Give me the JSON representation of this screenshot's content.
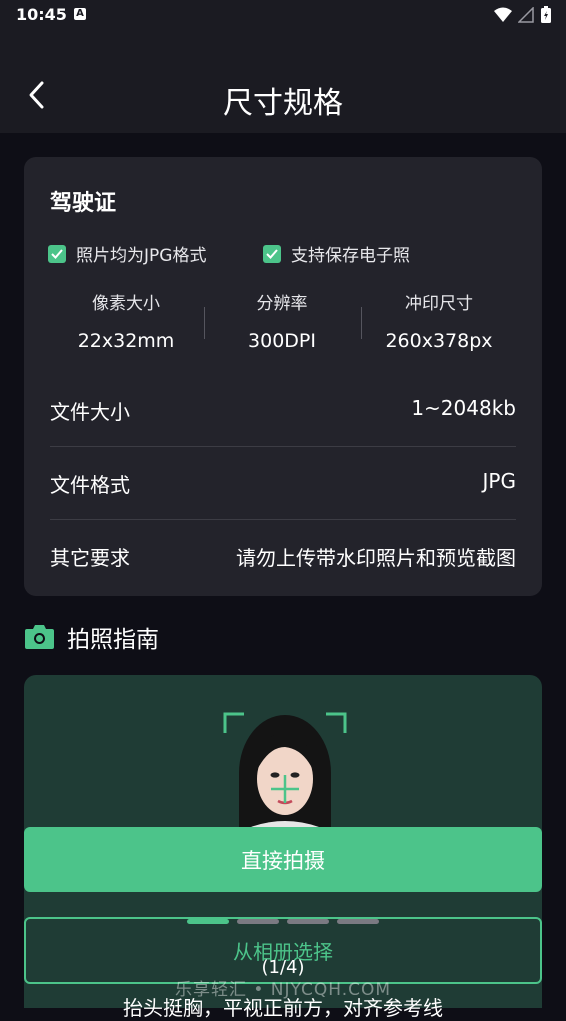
{
  "status_bar": {
    "time": "10:45",
    "notification_glyph": "A"
  },
  "header": {
    "title": "尺寸规格"
  },
  "spec": {
    "title": "驾驶证",
    "checks": [
      "照片均为JPG格式",
      "支持保存电子照"
    ],
    "metrics": [
      {
        "label": "像素大小",
        "value": "22x32mm"
      },
      {
        "label": "分辨率",
        "value": "300DPI"
      },
      {
        "label": "冲印尺寸",
        "value": "260x378px"
      }
    ],
    "rows": [
      {
        "label": "文件大小",
        "value": "1~2048kb"
      },
      {
        "label": "文件格式",
        "value": "JPG"
      },
      {
        "label": "其它要求",
        "value": "请勿上传带水印照片和预览截图"
      }
    ]
  },
  "guide": {
    "title": "拍照指南",
    "page_indicator": "(1/4)",
    "caption": "抬头挺胸，平视正前方，对齐参考线"
  },
  "actions": {
    "shoot": "直接拍摄",
    "album": "从相册选择"
  },
  "watermark": "乐享轻汇 • NJYCQH.COM",
  "colors": {
    "accent": "#4cc48a",
    "background": "#0e0e16",
    "card": "#23232b",
    "header": "#1b1b22",
    "guide_bg": "#1f3c35"
  }
}
